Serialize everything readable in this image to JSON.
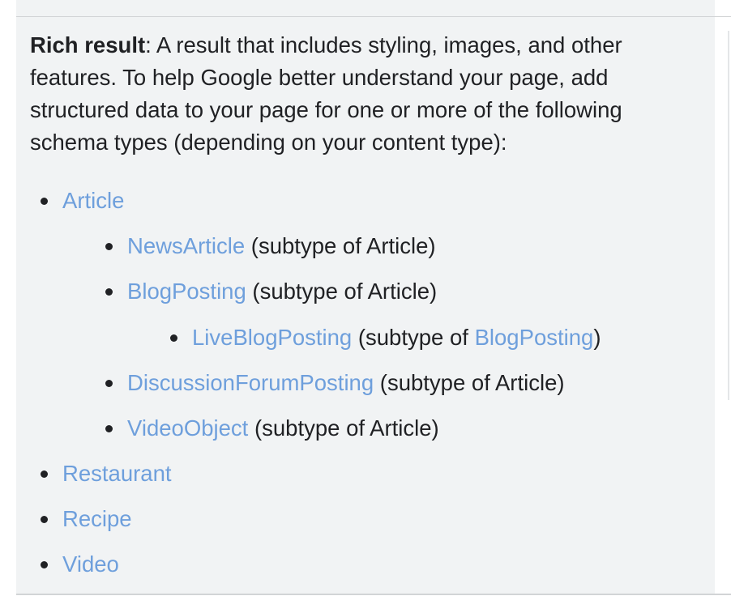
{
  "description": {
    "term": "Rich result",
    "text": ": A result that includes styling, images, and other features. To help Google better understand your page, add structured data to your page for one or more of the following schema types (depending on your content type):"
  },
  "schema_list": {
    "article": {
      "link": "Article"
    },
    "news_article": {
      "link": "NewsArticle",
      "note": " (subtype of Article)"
    },
    "blog_posting": {
      "link": "BlogPosting",
      "note": " (subtype of Article)"
    },
    "live_blog_posting": {
      "link": "LiveBlogPosting",
      "note_prefix": " (subtype of ",
      "parent_link": "BlogPosting",
      "note_suffix": ")"
    },
    "discussion_forum_posting": {
      "link": "DiscussionForumPosting",
      "note": " (subtype of Article)"
    },
    "video_object": {
      "link": "VideoObject",
      "note": " (subtype of Article)"
    },
    "restaurant": {
      "link": "Restaurant"
    },
    "recipe": {
      "link": "Recipe"
    },
    "video": {
      "link": "Video"
    }
  },
  "colors": {
    "background": "#f1f3f4",
    "text": "#202124",
    "link": "#6e9fdc",
    "divider": "#d2d4d6"
  }
}
